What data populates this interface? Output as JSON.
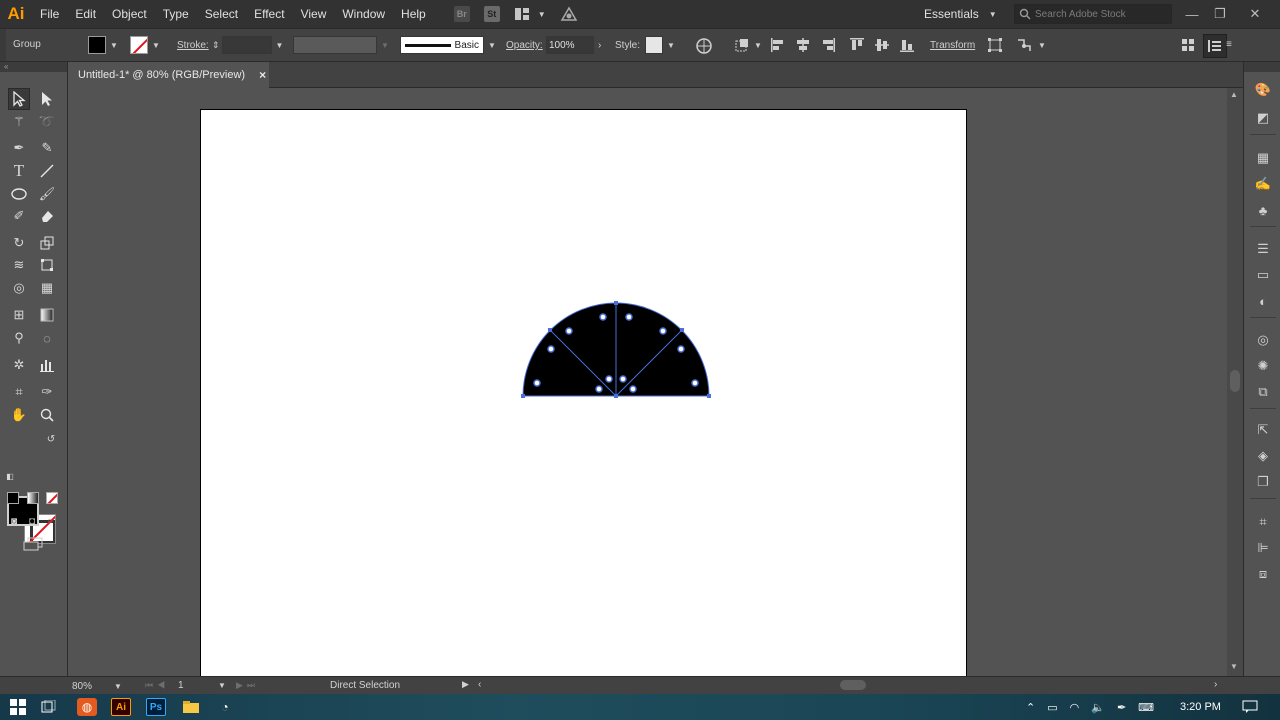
{
  "app": {
    "logo": "Ai"
  },
  "menu": {
    "items": [
      "File",
      "Edit",
      "Object",
      "Type",
      "Select",
      "Effect",
      "View",
      "Window",
      "Help"
    ],
    "bridge_icon": "Br",
    "stock_icon": "St",
    "workspace": "Essentials",
    "search_placeholder": "Search Adobe Stock"
  },
  "control": {
    "selection_label": "Group",
    "stroke_label": "Stroke:",
    "brush_label": "Basic",
    "opacity_label": "Opacity:",
    "opacity_value": "100%",
    "style_label": "Style:",
    "transform_label": "Transform"
  },
  "document": {
    "tab_title": "Untitled-1* @ 80% (RGB/Preview)",
    "close_glyph": "×"
  },
  "status": {
    "zoom": "80%",
    "artboard_number": "1",
    "current_tool": "Direct Selection"
  },
  "taskbar": {
    "time": "3:20 PM",
    "apps": [
      {
        "label": "Ai",
        "color": "#ff9a00",
        "bg": "#330000"
      },
      {
        "label": "Ps",
        "color": "#31a8ff",
        "bg": "#001e36"
      }
    ]
  },
  "colors": {
    "anchor": "#4a6fd8",
    "shape_fill": "#000000",
    "stroke_none": "#e0141e"
  }
}
